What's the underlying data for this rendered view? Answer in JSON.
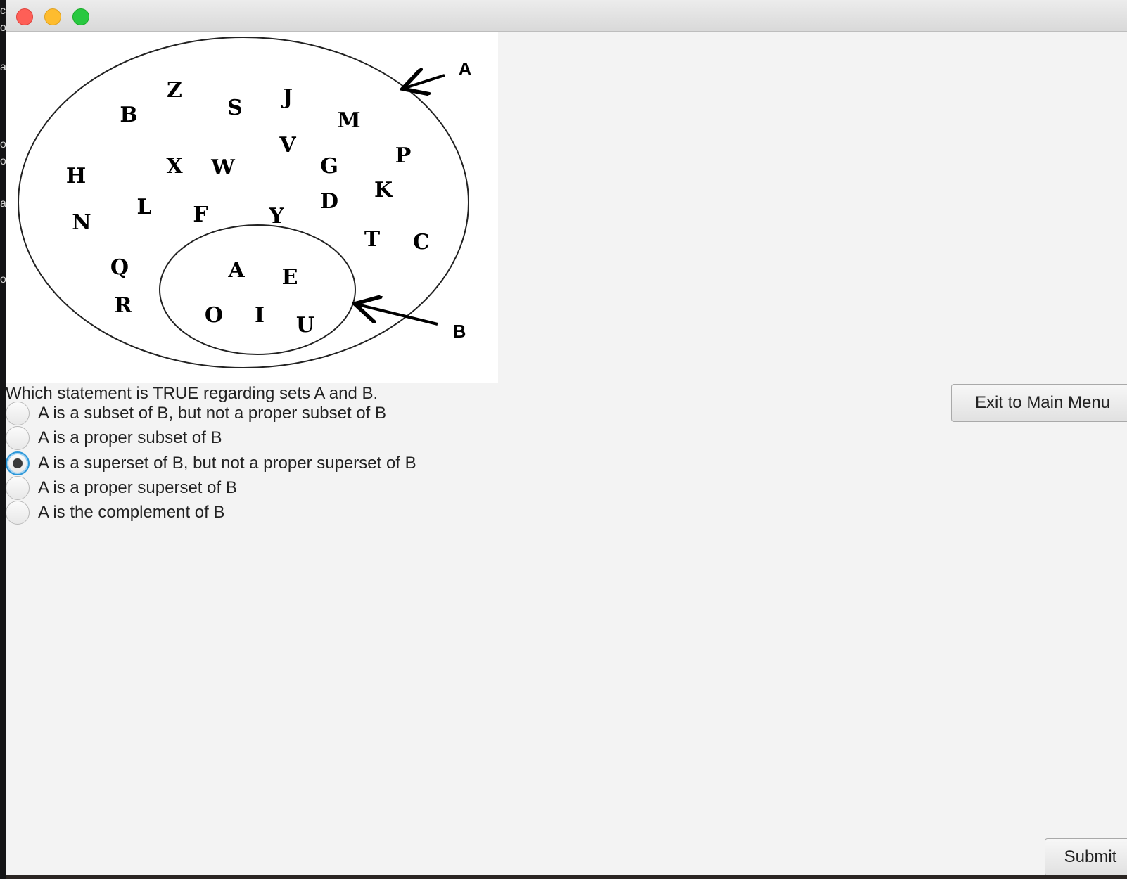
{
  "diagram": {
    "outer_letters": [
      "Z",
      "J",
      "B",
      "S",
      "M",
      "V",
      "P",
      "H",
      "X",
      "W",
      "G",
      "K",
      "L",
      "D",
      "N",
      "F",
      "Y",
      "T",
      "C",
      "Q",
      "R"
    ],
    "inner_letters": [
      "A",
      "E",
      "O",
      "I",
      "U"
    ],
    "label_outer": "A",
    "label_inner": "B"
  },
  "question": {
    "text": "Which statement is TRUE regarding sets A and B.",
    "options": [
      {
        "label": "A is a subset of B, but not a proper subset of B",
        "selected": false
      },
      {
        "label": "A is a proper subset of B",
        "selected": false
      },
      {
        "label": "A is a superset of B, but not a proper superset of B",
        "selected": true
      },
      {
        "label": "A is a proper superset of B",
        "selected": false
      },
      {
        "label": "A is the complement of B",
        "selected": false
      }
    ]
  },
  "buttons": {
    "exit_label": "Exit to Main Menu",
    "submit_label": "Submit"
  },
  "colors": {
    "window_bg": "#f3f3f3",
    "focus_ring": "#2b97d9"
  }
}
